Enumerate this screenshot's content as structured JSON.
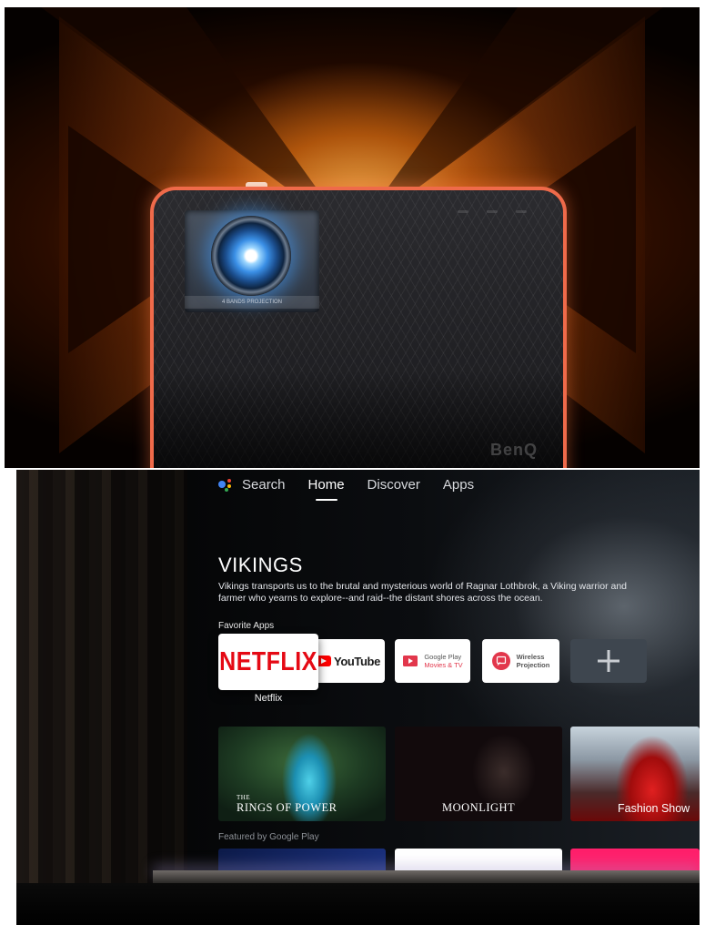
{
  "projector": {
    "lens_label": "4 BANDS PROJECTION",
    "brand": "BenQ"
  },
  "tv_ui": {
    "nav": {
      "search_label": "Search",
      "tabs": [
        {
          "label": "Home",
          "active": true
        },
        {
          "label": "Discover",
          "active": false
        },
        {
          "label": "Apps",
          "active": false
        }
      ]
    },
    "feature": {
      "title": "VIKINGS",
      "description": "Vikings transports us to the brutal and mysterious world of Ragnar Lothbrok, a Viking warrior and farmer who yearns to explore--and raid--the distant shores across the ocean."
    },
    "favorite_apps": {
      "section_label": "Favorite Apps",
      "selected_caption": "Netflix",
      "apps": {
        "netflix": "NETFLIX",
        "youtube": "YouTube",
        "google_play_line1": "Google Play",
        "google_play_line2": "Movies & TV",
        "wireless_line1": "Wireless",
        "wireless_line2": "Projection"
      },
      "add_symbol": "+"
    },
    "posters": [
      {
        "title_line1": "THE",
        "title_line2": "RINGS OF POWER"
      },
      {
        "title": "MOONLIGHT"
      },
      {
        "title": "Fashion Show"
      }
    ],
    "featured": {
      "section_label": "Featured by Google Play"
    },
    "colors": {
      "netflix_red": "#e50914",
      "youtube_red": "#ff0000",
      "play_red": "#e2374c",
      "projector_trim": "#ef6a4a"
    }
  }
}
